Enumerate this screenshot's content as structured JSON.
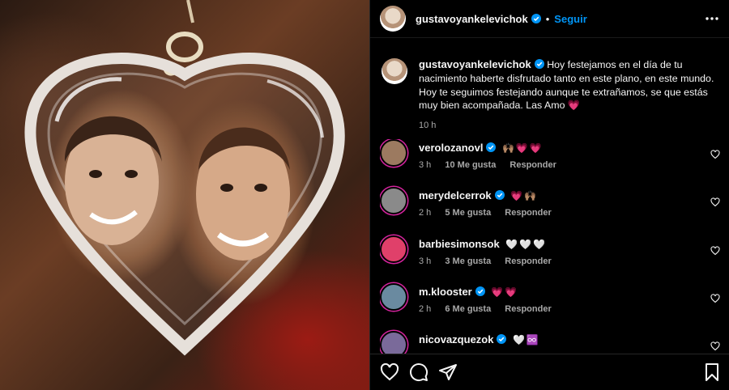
{
  "post": {
    "author": "gustavoyankelevichok",
    "follow_label": "Seguir",
    "separator": "•",
    "caption": "Hoy festejamos en el día de tu nacimiento haberte disfrutado tanto en este plano, en este mundo. Hoy te seguimos festejando aunque te extrañamos, se que estás muy bien acompañada. Las Amo",
    "caption_emoji": "💗",
    "caption_time": "10 h"
  },
  "comments": [
    {
      "user": "verolozanovl",
      "emoji": "🙌🏽💗💗",
      "time": "3 h",
      "likes": "10 Me gusta",
      "reply": "Responder",
      "avatar_color": "#9c7a60"
    },
    {
      "user": "merydelcerrok",
      "emoji": "💗🙌🏽",
      "time": "2 h",
      "likes": "5 Me gusta",
      "reply": "Responder",
      "avatar_color": "#8a8a8a"
    },
    {
      "user": "barbiesimonsok",
      "emoji": "🤍🤍🤍",
      "time": "3 h",
      "likes": "3 Me gusta",
      "reply": "Responder",
      "avatar_color": "#e0406a"
    },
    {
      "user": "m.klooster",
      "emoji": "💗💗",
      "time": "2 h",
      "likes": "6 Me gusta",
      "reply": "Responder",
      "avatar_color": "#6a8aa0"
    },
    {
      "user": "nicovazquezok",
      "emoji": "🤍♾️",
      "time": "",
      "likes": "",
      "reply": "",
      "avatar_color": "#7a6a9a"
    }
  ],
  "icons": {
    "verified": "verified-badge-icon",
    "more": "more-options-icon",
    "like": "heart-icon",
    "comment": "comment-icon",
    "share": "share-icon",
    "save": "bookmark-icon"
  },
  "colors": {
    "accent": "#0095f6",
    "background": "#000000",
    "secondary_text": "#a8a8a8"
  }
}
